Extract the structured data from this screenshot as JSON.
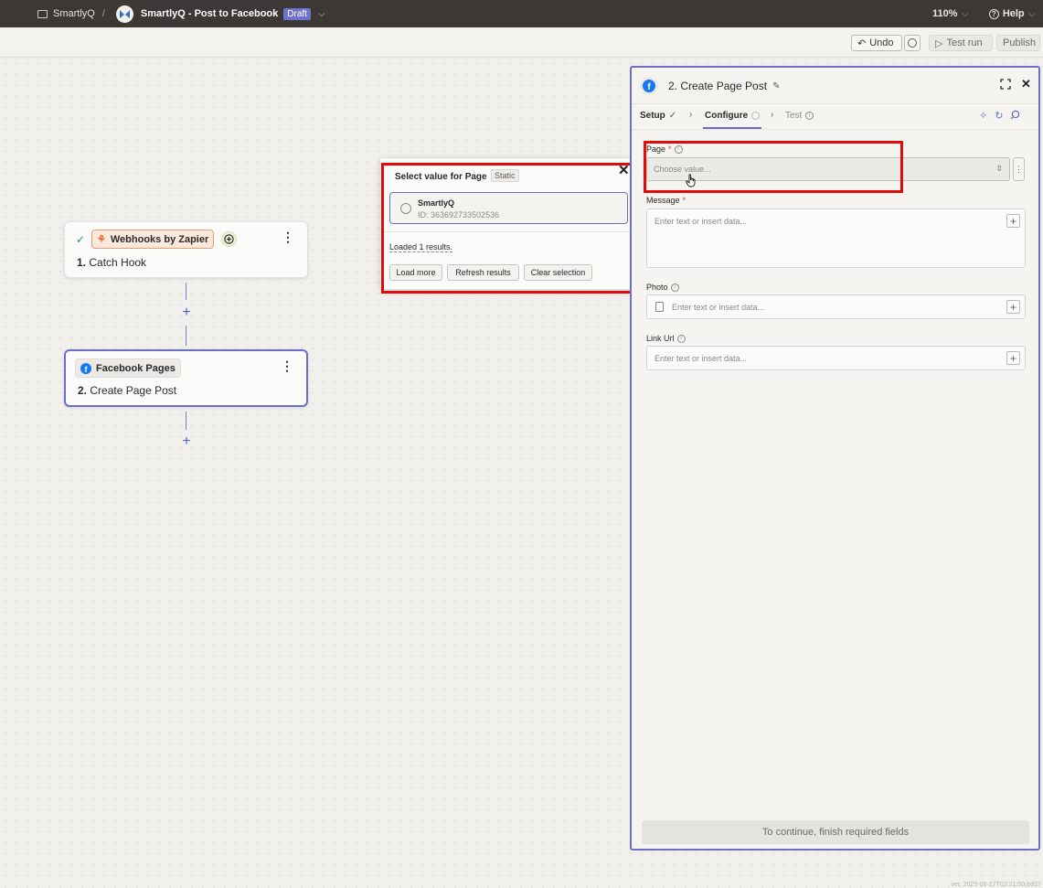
{
  "topbar": {
    "folder": "SmartlyQ",
    "separator": "/",
    "zap_name": "SmartlyQ - Post to Facebook",
    "status": "Draft",
    "zoom": "110%",
    "help": "Help"
  },
  "toolbar": {
    "undo": "Undo",
    "test_run": "Test run",
    "publish": "Publish"
  },
  "nodes": [
    {
      "app": "Webhooks by Zapier",
      "step_num": "1.",
      "step": "Catch Hook"
    },
    {
      "app": "Facebook Pages",
      "step_num": "2.",
      "step": "Create Page Post"
    }
  ],
  "popup": {
    "title": "Select value for Page",
    "badge": "Static",
    "option_name": "SmartlyQ",
    "option_id": "ID: 363692733502536",
    "loaded": "Loaded 1 results.",
    "buttons": [
      "Load more",
      "Refresh results",
      "Clear selection"
    ]
  },
  "panel": {
    "title": "2. Create Page Post",
    "tabs": [
      "Setup",
      "Configure",
      "Test"
    ],
    "fields": {
      "page_label": "Page",
      "page_placeholder": "Choose value...",
      "message_label": "Message",
      "message_placeholder": "Enter text or insert data...",
      "photo_label": "Photo",
      "photo_placeholder": "Enter text or insert data...",
      "link_label": "Link Url",
      "link_placeholder": "Enter text or insert data..."
    },
    "continue_label": "To continue, finish required fields"
  },
  "colors": {
    "accent": "#6c6fc6",
    "highlight": "#e10b0b",
    "topbar": "#3b3835"
  },
  "version": "ver. 2025-08-27T03:21:00-bd37"
}
